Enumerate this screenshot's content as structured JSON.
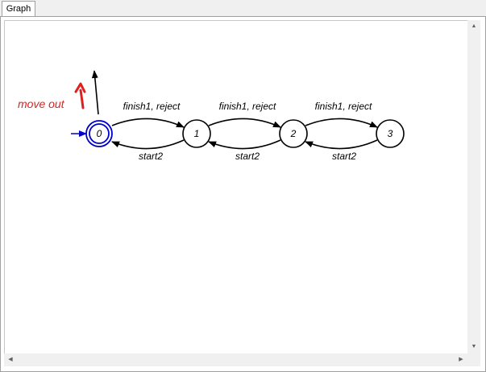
{
  "tabs": [
    {
      "label": "Graph"
    }
  ],
  "annotation": {
    "text": "move out",
    "color": "#e02020"
  },
  "colors": {
    "initial_state": "#0000cc",
    "edge": "#000000",
    "background": "#ffffff"
  },
  "states": [
    {
      "label": "0",
      "initial": true
    },
    {
      "label": "1",
      "initial": false
    },
    {
      "label": "2",
      "initial": false
    },
    {
      "label": "3",
      "initial": false
    }
  ],
  "transitions": [
    {
      "from": "0",
      "to": "1",
      "label": "finish1, reject"
    },
    {
      "from": "1",
      "to": "0",
      "label": "start2"
    },
    {
      "from": "1",
      "to": "2",
      "label": "finish1, reject"
    },
    {
      "from": "2",
      "to": "1",
      "label": "start2"
    },
    {
      "from": "2",
      "to": "3",
      "label": "finish1, reject"
    },
    {
      "from": "3",
      "to": "2",
      "label": "start2"
    }
  ],
  "scrollbar_icons": {
    "up": "up-arrow-icon",
    "down": "down-arrow-icon",
    "left": "left-arrow-icon",
    "right": "right-arrow-icon"
  }
}
